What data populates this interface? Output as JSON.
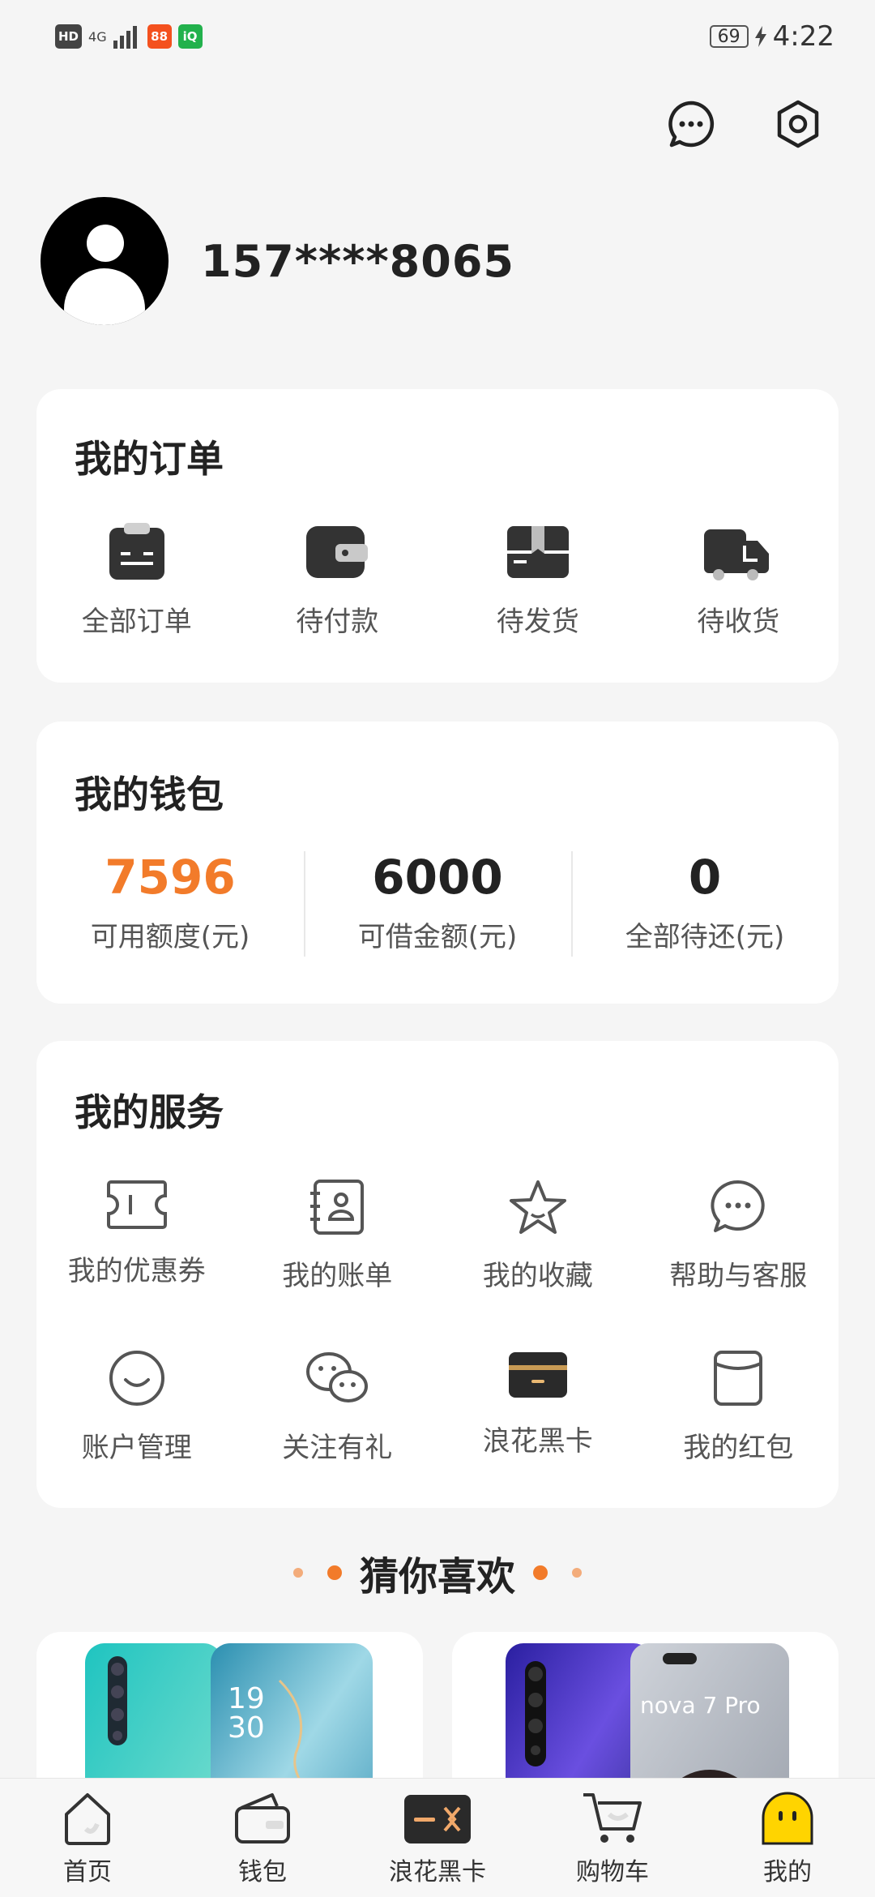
{
  "status_bar": {
    "time": "4:22",
    "battery": "69",
    "hd": "HD",
    "network": "4G"
  },
  "top_actions": [
    "message-icon",
    "settings-icon"
  ],
  "profile": {
    "phone": "157****8065"
  },
  "orders": {
    "title": "我的订单",
    "items": [
      {
        "label": "全部订单",
        "icon": "clipboard-icon"
      },
      {
        "label": "待付款",
        "icon": "wallet-icon"
      },
      {
        "label": "待发货",
        "icon": "package-icon"
      },
      {
        "label": "待收货",
        "icon": "truck-icon"
      }
    ]
  },
  "wallet": {
    "title": "我的钱包",
    "stats": [
      {
        "value": "7596",
        "label": "可用额度(元)"
      },
      {
        "value": "6000",
        "label": "可借金额(元)"
      },
      {
        "value": "0",
        "label": "全部待还(元)"
      }
    ]
  },
  "services": {
    "title": "我的服务",
    "items": [
      {
        "label": "我的优惠券",
        "icon": "coupon-icon"
      },
      {
        "label": "我的账单",
        "icon": "bill-icon"
      },
      {
        "label": "我的收藏",
        "icon": "star-icon"
      },
      {
        "label": "帮助与客服",
        "icon": "chat-icon"
      },
      {
        "label": "账户管理",
        "icon": "smile-icon"
      },
      {
        "label": "关注有礼",
        "icon": "wechat-icon"
      },
      {
        "label": "浪花黑卡",
        "icon": "black-card-icon"
      },
      {
        "label": "我的红包",
        "icon": "red-packet-icon"
      }
    ]
  },
  "recommend": {
    "title": "猜你喜欢"
  },
  "products": [
    {
      "name": "phone-product-1",
      "screen_text": "19\n30"
    },
    {
      "name": "phone-product-2",
      "brand_text": "nova 7 Pro"
    }
  ],
  "tabbar": {
    "items": [
      {
        "label": "首页",
        "icon": "home-icon"
      },
      {
        "label": "钱包",
        "icon": "wallet-icon"
      },
      {
        "label": "浪花黑卡",
        "icon": "black-card-icon"
      },
      {
        "label": "购物车",
        "icon": "cart-icon"
      },
      {
        "label": "我的",
        "icon": "mascot-icon"
      }
    ]
  },
  "colors": {
    "accent": "#f27b2a",
    "background": "#f5f5f5",
    "card": "#ffffff"
  }
}
